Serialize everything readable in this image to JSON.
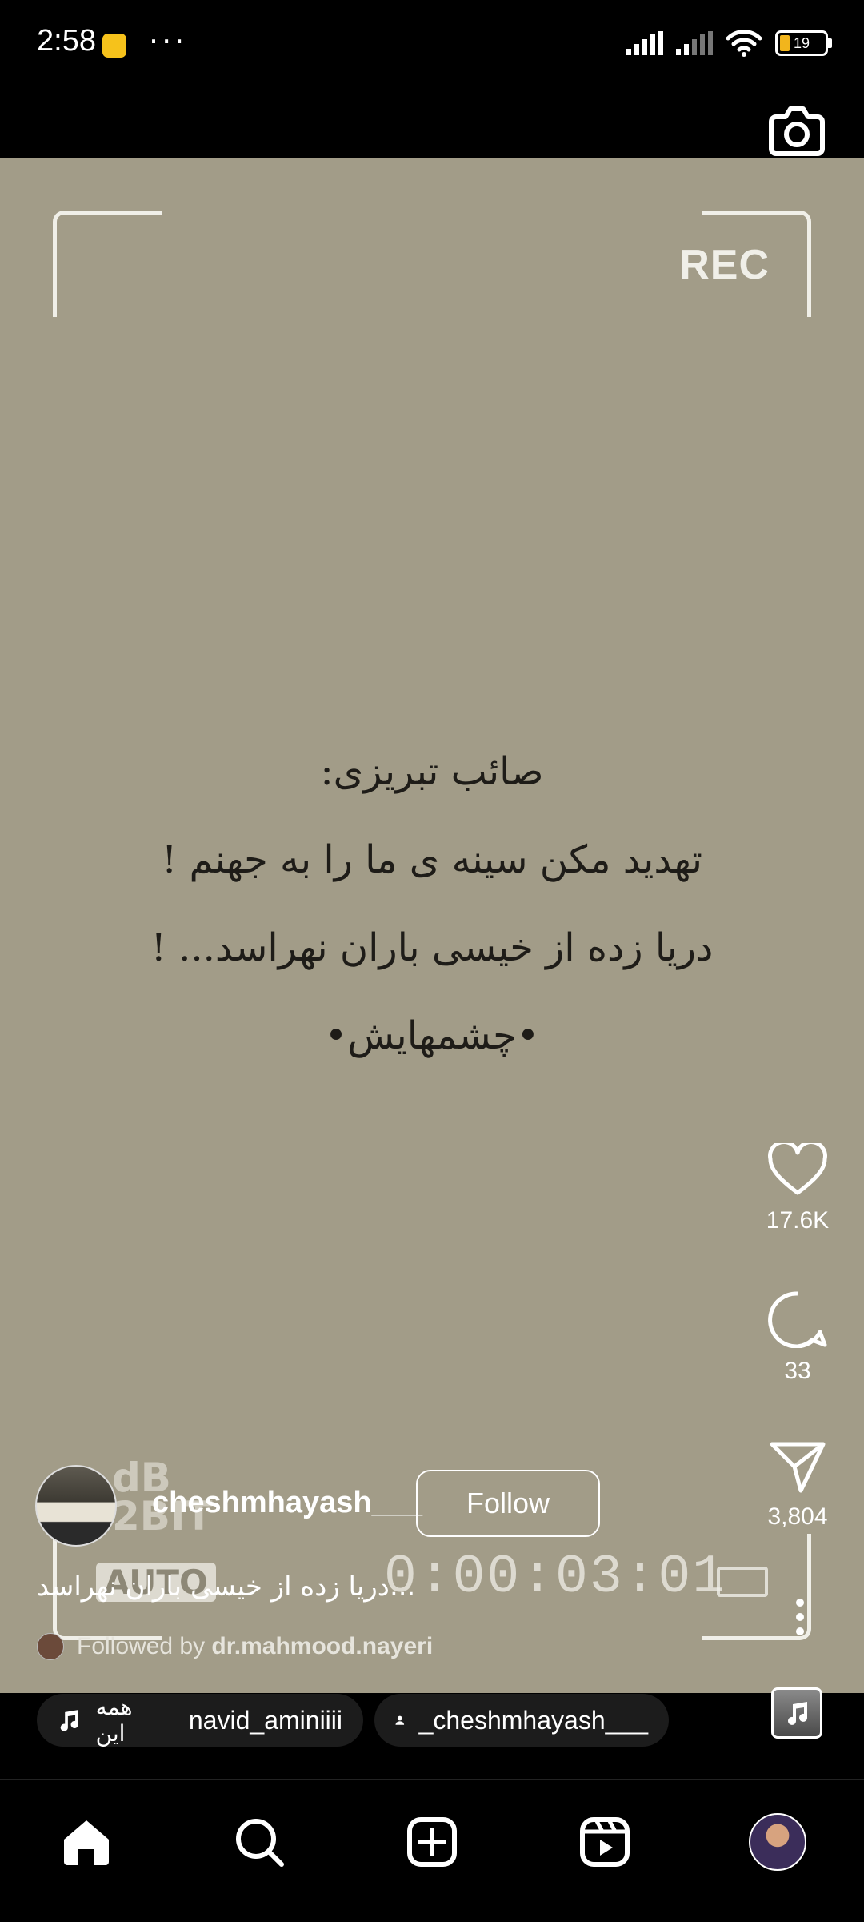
{
  "status_bar": {
    "time": "2:58",
    "dots": "···",
    "battery_level": "19"
  },
  "video": {
    "rec_label": "REC",
    "poem_lines": [
      "صائب تبریزی:",
      "تهدید مکن سینه ی ما را به جهنم !",
      "دریا زده از خیسی باران نهراسد... !",
      "•چشمهایش•"
    ],
    "overlay_db": "dB",
    "overlay_bit": "2BIT",
    "overlay_auto": "AUTO",
    "overlay_timer": "0:00:03:01"
  },
  "actions": {
    "likes": "17.6K",
    "comments": "33",
    "shares": "3,804"
  },
  "post": {
    "username": "cheshmhayash___",
    "follow_label": "Follow",
    "caption": "دریا زده از خیسی باران نهراسد...",
    "followed_by_prefix": "Followed by",
    "followed_by_user": "dr.mahmood.nayeri"
  },
  "pills": {
    "audio_title": "همه این",
    "audio_artist": "navid_aminiiii",
    "tagged_user": "_cheshmhayash___"
  },
  "colors": {
    "video_bg": "#a29c88",
    "battery_fill": "#f2b51c"
  },
  "icons": {
    "like": "heart-icon",
    "comment": "comment-icon",
    "share": "send-icon",
    "more": "more-vertical-icon",
    "camera": "camera-icon",
    "home": "home-icon",
    "search": "search-icon",
    "create": "plus-square-icon",
    "reels": "reels-icon"
  }
}
